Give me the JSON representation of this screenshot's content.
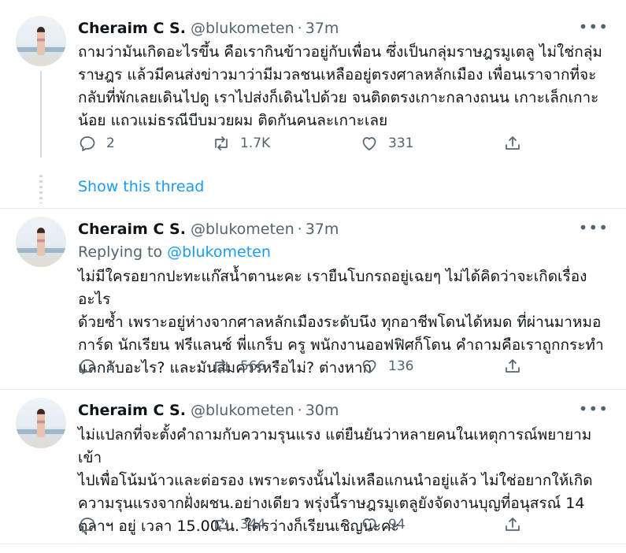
{
  "tweets": [
    {
      "name": "Cheraim C S.",
      "handle": "@blukometen",
      "time": "37m",
      "text": "ถามว่ามันเกิดอะไรขึ้น คือเรากินข้าวอยู่กับเพื่อน ซึ่งเป็นกลุ่มราษฎรมูเตลู ไม่ใช่กลุ่ม\nราษฎร แล้วมีคนส่งข่าวมาว่ามีมวลชนเหลืออยู่ตรงศาลหลักเมือง เพื่อนเราจากที่จะ\nกลับที่พักเลยเดินไปดู เราไปส่งก็เดินไปด้วย จนติดตรงเกาะกลางถนน เกาะเล็กเกาะ\nน้อย แถวแม่ธรณีบีบมวยผม ติดกันคนละเกาะเลย",
      "replies": "2",
      "retweets": "1.7K",
      "likes": "331",
      "show_thread": "Show this thread"
    },
    {
      "name": "Cheraim C S.",
      "handle": "@blukometen",
      "time": "37m",
      "replying_prefix": "Replying to",
      "replying_to": "@blukometen",
      "text": "ไม่มีใครอยากปะทะแก๊สน้ำตานะคะ เรายืนโบกรถอยู่เฉยๆ ไม่ได้คิดว่าจะเกิดเรื่องอะไร\nด้วยซ้ำ เพราะอยู่ห่างจากศาลหลักเมืองระดับนึง ทุกอาชีพโดนได้หมด ที่ผ่านมาหมอ\nการ์ด นักเรียน ฟรีแลนซ์ พี่แกร็บ ครู พนักงานออฟฟิศก็โดน คำถามคือเราถูกกระทำ\nแลกกับอะไร? และมันสมควรหรือไม่? ต่างหาก",
      "replies": "1",
      "retweets": "566",
      "likes": "136"
    },
    {
      "name": "Cheraim C S.",
      "handle": "@blukometen",
      "time": "30m",
      "text": "ไม่แปลกที่จะตั้งคำถามกับความรุนแรง แต่ยืนยันว่าหลายคนในเหตุการณ์พยายามเข้า\nไปเพื่อโน้มน้าวและต่อรอง เพราะตรงนั้นไม่เหลือแกนนำอยู่แล้ว ไม่ใช่อยากให้เกิด\nความรุนแรงจากฝั่งผชน.อย่างเดียว พรุ่งนี้ราษฎรมูเตลูยังจัดงานบุญที่อนุสรณ์ 14\nตุลาฯ อยู่ เวลา 15.00 น. ใครว่างก็เรียนเชิญนะคะ",
      "replies": "",
      "retweets": "344",
      "likes": "94"
    }
  ],
  "icons": {
    "reply": "reply-icon",
    "retweet": "retweet-icon",
    "like": "heart-icon",
    "share": "share-icon",
    "more": "more-icon"
  },
  "colors": {
    "accent": "#1d9bf0",
    "secondary": "#536471",
    "divider": "#e6ecf0"
  }
}
